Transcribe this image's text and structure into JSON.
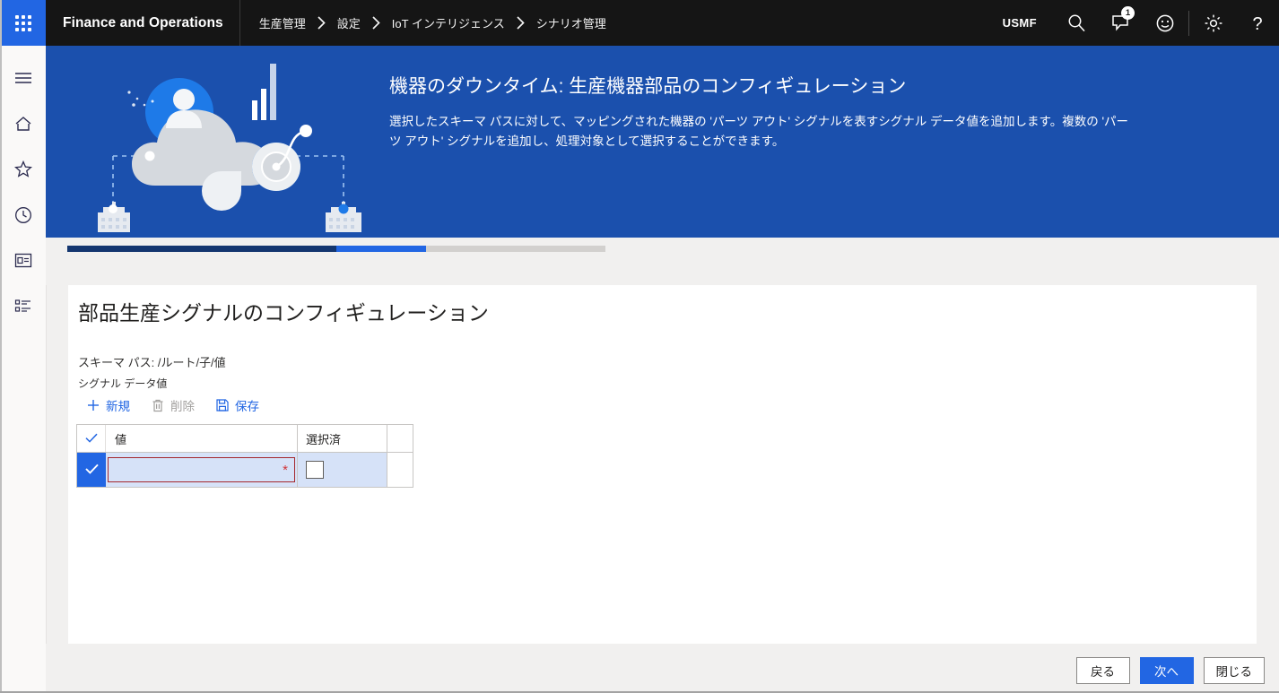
{
  "topbar": {
    "waffle_label": "app-launcher",
    "brand": "Finance and Operations",
    "breadcrumbs": [
      {
        "label": "生産管理"
      },
      {
        "label": "設定"
      },
      {
        "label": "IoT インテリジェンス"
      },
      {
        "label": "シナリオ管理"
      }
    ],
    "company": "USMF",
    "search_icon": "search-icon",
    "notifications_icon": "notification-icon",
    "notifications_count": "1",
    "feedback_icon": "smiley-icon",
    "settings_icon": "gear-icon",
    "help_icon": "help-icon"
  },
  "sidebar": {
    "items": [
      {
        "icon": "hamburger-menu-icon",
        "name": "navigation-menu"
      },
      {
        "icon": "home-icon",
        "name": "home"
      },
      {
        "icon": "star-icon",
        "name": "favorites"
      },
      {
        "icon": "clock-icon",
        "name": "recent"
      },
      {
        "icon": "workspace-icon",
        "name": "workspaces"
      },
      {
        "icon": "list-icon",
        "name": "modules"
      }
    ]
  },
  "hero": {
    "title": "機器のダウンタイム: 生産機器部品のコンフィギュレーション",
    "description": "選択したスキーマ パスに対して、マッピングされた機器の 'パーツ アウト' シグナルを表すシグナル データ値を追加します。複数の 'パーツ アウト' シグナルを追加し、処理対象として選択することができます。",
    "illustration": "iot-cloud-illustration",
    "background_color": "#1b50ad"
  },
  "steps": {
    "accent_done": "#14366f",
    "accent_current": "#2266e3",
    "accent_todo": "#d2d0ce",
    "items": [
      {
        "state": "done"
      },
      {
        "state": "done"
      },
      {
        "state": "done"
      },
      {
        "state": "current"
      },
      {
        "state": "todo"
      },
      {
        "state": "todo"
      }
    ]
  },
  "main": {
    "title": "部品生産シグナルのコンフィギュレーション",
    "schema_path": "スキーマ パス: /ルート/子/値",
    "sublabel": "シグナル データ値",
    "toolbar": [
      {
        "label": "新規",
        "icon": "plus-icon",
        "enabled": true
      },
      {
        "label": "削除",
        "icon": "trash-icon",
        "enabled": false
      },
      {
        "label": "保存",
        "icon": "save-icon",
        "enabled": true
      }
    ],
    "grid": {
      "columns": [
        "値",
        "選択済"
      ],
      "select_all_icon": "checkmark-icon",
      "rows": [
        {
          "selected": true,
          "row_check_icon": "checkmark-icon",
          "value": "",
          "value_required_marker": "*",
          "checked": false
        }
      ]
    }
  },
  "footer": {
    "back_label": "戻る",
    "next_label": "次へ",
    "close_label": "閉じる"
  }
}
